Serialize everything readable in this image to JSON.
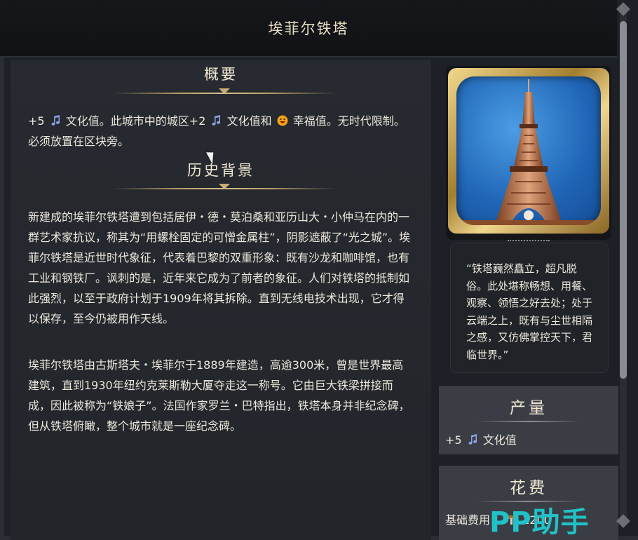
{
  "window": {
    "title": "埃菲尔铁塔"
  },
  "overview": {
    "heading": "概要",
    "text_a": "+5",
    "text_b": "文化值。此城市中的城区+2",
    "text_c": "文化值和",
    "text_d": "幸福值。无时代限制。必须放置在区块旁。"
  },
  "history": {
    "heading": "历史背景",
    "paragraph1": "新建成的埃菲尔铁塔遭到包括居伊・德・莫泊桑和亚历山大・小仲马在内的一群艺术家抗议，称其为“用螺栓固定的可憎金属柱”，阴影遮蔽了“光之城”。埃菲尔铁塔是近世时代象征，代表着巴黎的双重形象：既有沙龙和咖啡馆，也有工业和钢铁厂。讽刺的是，近年来它成为了前者的象征。人们对铁塔的抵制如此强烈，以至于政府计划于1909年将其拆除。直到无线电技术出现，它才得以保存，至今仍被用作天线。",
    "paragraph2": "埃菲尔铁塔由古斯塔夫・埃菲尔于1889年建造，高逾300米，曾是世界最高建筑，直到1930年纽约克莱斯勒大厦夺走这一称号。它由巨大铁梁拼接而成，因此被称为“铁娘子”。法国作家罗兰・巴特指出，铁塔本身并非纪念碑，但从铁塔俯瞰，整个城市就是一座纪念碑。"
  },
  "quote": "“铁塔巍然矗立，超凡脱俗。此处堪称畅想、用餐、观察、领悟之好去处；处于云端之上，既有与尘世相隔之感，又仿佛掌控天下，君临世界。”",
  "yield": {
    "heading": "产量",
    "value": "+5",
    "label": "文化值"
  },
  "cost": {
    "heading": "花费",
    "label": "基础费用：",
    "value": "1200"
  },
  "watermark": "PP助手",
  "icons": {
    "culture": "music-note-icon",
    "happiness": "smiley-icon",
    "production": "hammer-icon"
  },
  "colors": {
    "culture": "#8fa3e8",
    "happiness": "#f4a21c",
    "gold": "#d8c08a"
  }
}
